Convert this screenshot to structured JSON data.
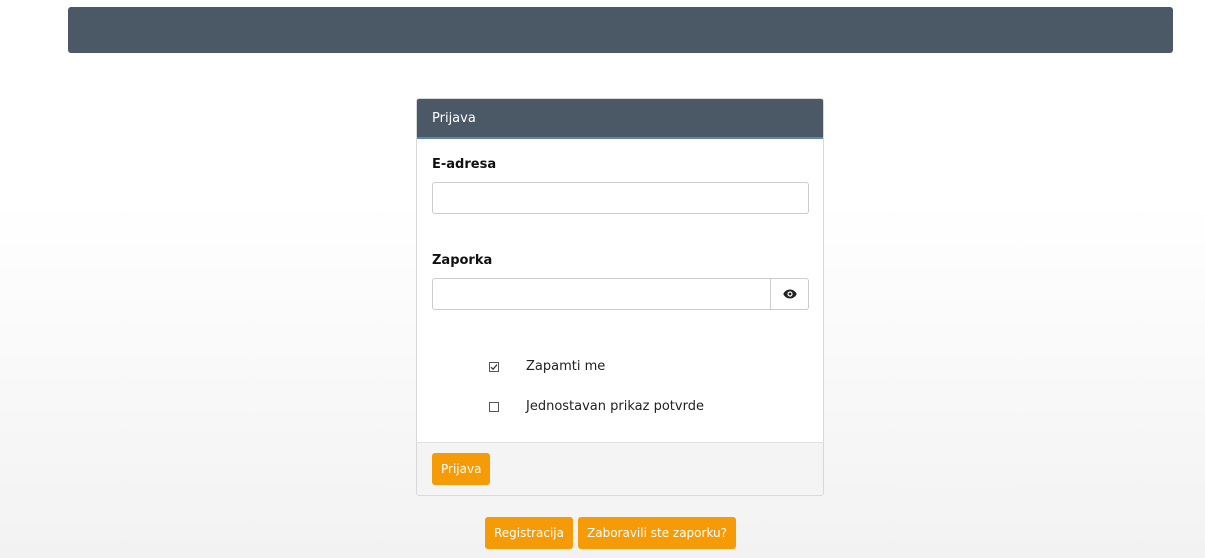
{
  "panel": {
    "title": "Prijava"
  },
  "form": {
    "email_label": "E-adresa",
    "email_value": "",
    "email_placeholder": "",
    "password_label": "Zaporka",
    "password_value": "",
    "password_placeholder": "",
    "show_password_icon": "eye-icon",
    "remember_label": "Zapamti me",
    "remember_checked": true,
    "simple_view_label": "Jednostavan prikaz potvrde",
    "simple_view_checked": false
  },
  "footer": {
    "login_button": "Prijava"
  },
  "links": {
    "register_button": "Registracija",
    "forgot_button": "Zaboravili ste zaporku?"
  },
  "colors": {
    "header": "#4b5966",
    "accent": "#f59b08"
  }
}
